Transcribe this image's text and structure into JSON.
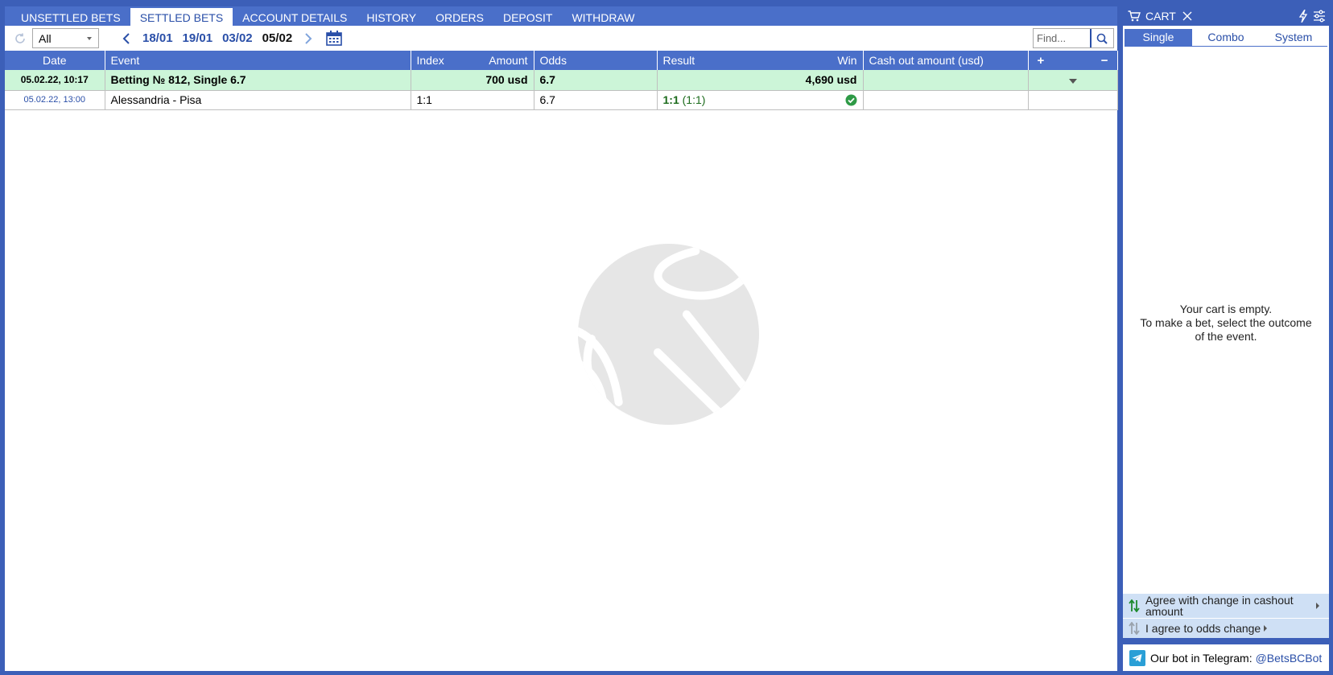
{
  "tabs": [
    {
      "label": "UNSETTLED BETS"
    },
    {
      "label": "SETTLED BETS"
    },
    {
      "label": "ACCOUNT DETAILS"
    },
    {
      "label": "HISTORY"
    },
    {
      "label": "ORDERS"
    },
    {
      "label": "DEPOSIT"
    },
    {
      "label": "WITHDRAW"
    }
  ],
  "active_tab": "SETTLED BETS",
  "toolbar": {
    "filter_value": "All",
    "dates": [
      "18/01",
      "19/01",
      "03/02",
      "05/02"
    ],
    "current_date": "05/02",
    "search_placeholder": "Find..."
  },
  "table": {
    "headers": {
      "date": "Date",
      "event": "Event",
      "index": "Index",
      "amount": "Amount",
      "odds": "Odds",
      "result": "Result",
      "win": "Win",
      "cashout": "Cash out amount (usd)",
      "plus": "+",
      "minus": "−"
    },
    "summary": {
      "date": "05.02.22,  10:17",
      "event": "Betting № 812, Single 6.7",
      "amount": "700 usd",
      "odds": "6.7",
      "win": "4,690 usd"
    },
    "detail": {
      "date": "05.02.22, 13:00",
      "event": "Alessandria - Pisa",
      "index": "1:1",
      "odds": "6.7",
      "result_score": "1:1",
      "result_ht": "(1:1)"
    }
  },
  "cart": {
    "title": "CART",
    "tabs": [
      "Single",
      "Combo",
      "System"
    ],
    "active_tab": "Single",
    "empty_line1": "Your cart is empty.",
    "empty_line2": "To make a bet, select the outcome",
    "empty_line3": "of the event.",
    "agree_cashout": "Agree with change in cashout amount",
    "agree_odds": "I agree to odds change",
    "telegram_text": "Our bot in Telegram:",
    "telegram_handle": "@BetsBCBot"
  },
  "colors": {
    "header_blue": "#4a6fc9",
    "frame_blue": "#3c5fb8",
    "win_green_row": "#ccf5d8",
    "link_blue": "#2a4fa8"
  }
}
